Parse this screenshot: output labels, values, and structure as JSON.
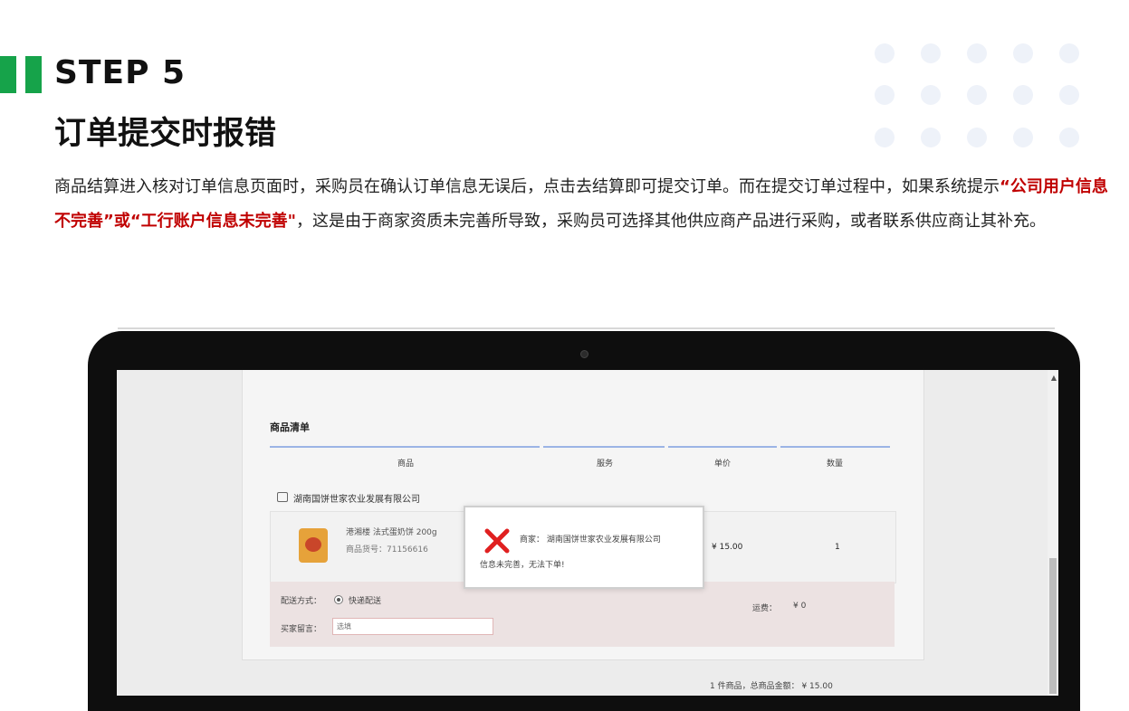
{
  "header": {
    "step": "STEP 5",
    "title": "订单提交时报错"
  },
  "description": {
    "part1": "商品结算进入核对订单信息页面时，采购员在确认订单信息无误后，点击去结算即可提交订单。而在提交订单过程中，如果系统提示",
    "highlight": "“公司用户信息不完善”或“工行账户信息未完善\"",
    "part2": "，这是由于商家资质未完善所导致，采购员可选择其他供应商产品进行采购，或者联系供应商让其补充。"
  },
  "colors": {
    "accent_green": "#16a34a",
    "error_red": "#c00000",
    "modal_x": "#e02020"
  },
  "screen": {
    "section_title": "商品清单",
    "columns": [
      "商品",
      "服务",
      "单价",
      "数量"
    ],
    "shop_name": "湖南国饼世家农业发展有限公司",
    "shop_icon": "store-icon",
    "product": {
      "name": "港湘楼 法式蛋奶饼 200g",
      "sku": "商品货号：71156616",
      "price": "¥ 15.00",
      "qty": "1"
    },
    "shipping": {
      "label": "配送方式：",
      "option": "快递配送",
      "fee_label": "运费：",
      "fee": "¥ 0",
      "note_label": "买家留言：",
      "note_placeholder": "选填"
    },
    "summary": "1 件商品，总商品金额：      ¥ 15.00"
  },
  "modal": {
    "icon": "close-icon",
    "line1": "商家：  湖南国饼世家农业发展有限公司",
    "line2": "信息未完善，无法下单!"
  }
}
